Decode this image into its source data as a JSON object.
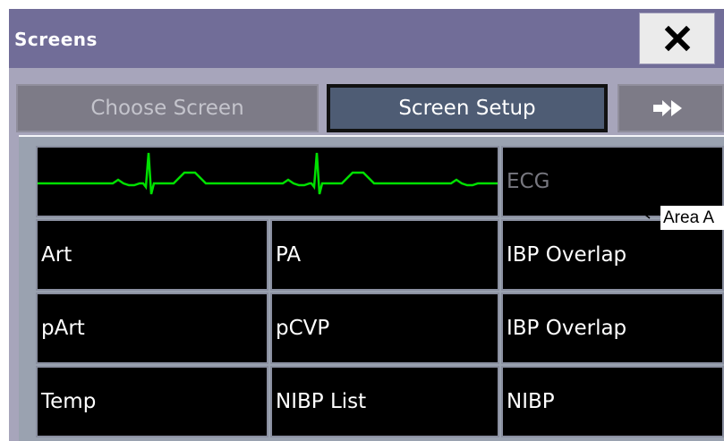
{
  "window": {
    "title": "Screens",
    "close_icon": "close-x-icon"
  },
  "tabs": [
    {
      "label": "Choose Screen",
      "state": "disabled"
    },
    {
      "label": "Screen Setup",
      "state": "selected"
    },
    {
      "icon": "double-arrow-right-icon"
    }
  ],
  "layout": {
    "waveform_row": {
      "waveform_icon": "ecg-waveform-icon",
      "waveform_color": "#00e000",
      "label": "ECG"
    },
    "rows": [
      [
        "Art",
        "PA",
        "IBP Overlap"
      ],
      [
        "pArt",
        "pCVP",
        "IBP Overlap"
      ],
      [
        "Temp",
        "NIBP List",
        "NIBP"
      ]
    ]
  },
  "annotation": {
    "label": "Area A"
  },
  "colors": {
    "titlebar": "#716d98",
    "window_background": "#a7a5bb",
    "selected_tab": "#4e5c74",
    "cell_background": "#000000"
  }
}
